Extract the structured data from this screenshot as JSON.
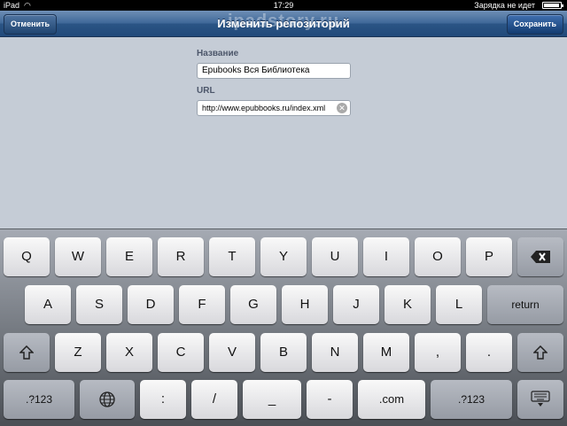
{
  "status_bar": {
    "carrier": "iPad",
    "wifi_icon": "wifi-icon",
    "time": "17:29",
    "charging": "Зарядка не идет",
    "battery_level": 0.85
  },
  "watermark": "ipadstory.ru",
  "nav": {
    "title": "Изменить репозиторий",
    "cancel": "Отменить",
    "save": "Сохранить"
  },
  "form": {
    "name_label": "Название",
    "name_value": "Epubooks Вся Библиотека",
    "url_label": "URL",
    "url_value": "http://www.epubbooks.ru/index.xml",
    "clear_icon": "clear-icon"
  },
  "keyboard": {
    "row1": [
      "Q",
      "W",
      "E",
      "R",
      "T",
      "Y",
      "U",
      "I",
      "O",
      "P"
    ],
    "row2": [
      "A",
      "S",
      "D",
      "F",
      "G",
      "H",
      "J",
      "K",
      "L"
    ],
    "row3": [
      "Z",
      "X",
      "C",
      "V",
      "B",
      "N",
      "M",
      ",",
      "."
    ],
    "row4": [
      ":",
      "/",
      "_",
      "-"
    ],
    "return": "return",
    "num1": ".?123",
    "num2": ".?123",
    "dotcom": ".com",
    "backspace_icon": "backspace-icon",
    "shift_icon": "shift-icon",
    "globe_icon": "globe-icon",
    "hide_keyboard_icon": "hide-keyboard-icon"
  }
}
